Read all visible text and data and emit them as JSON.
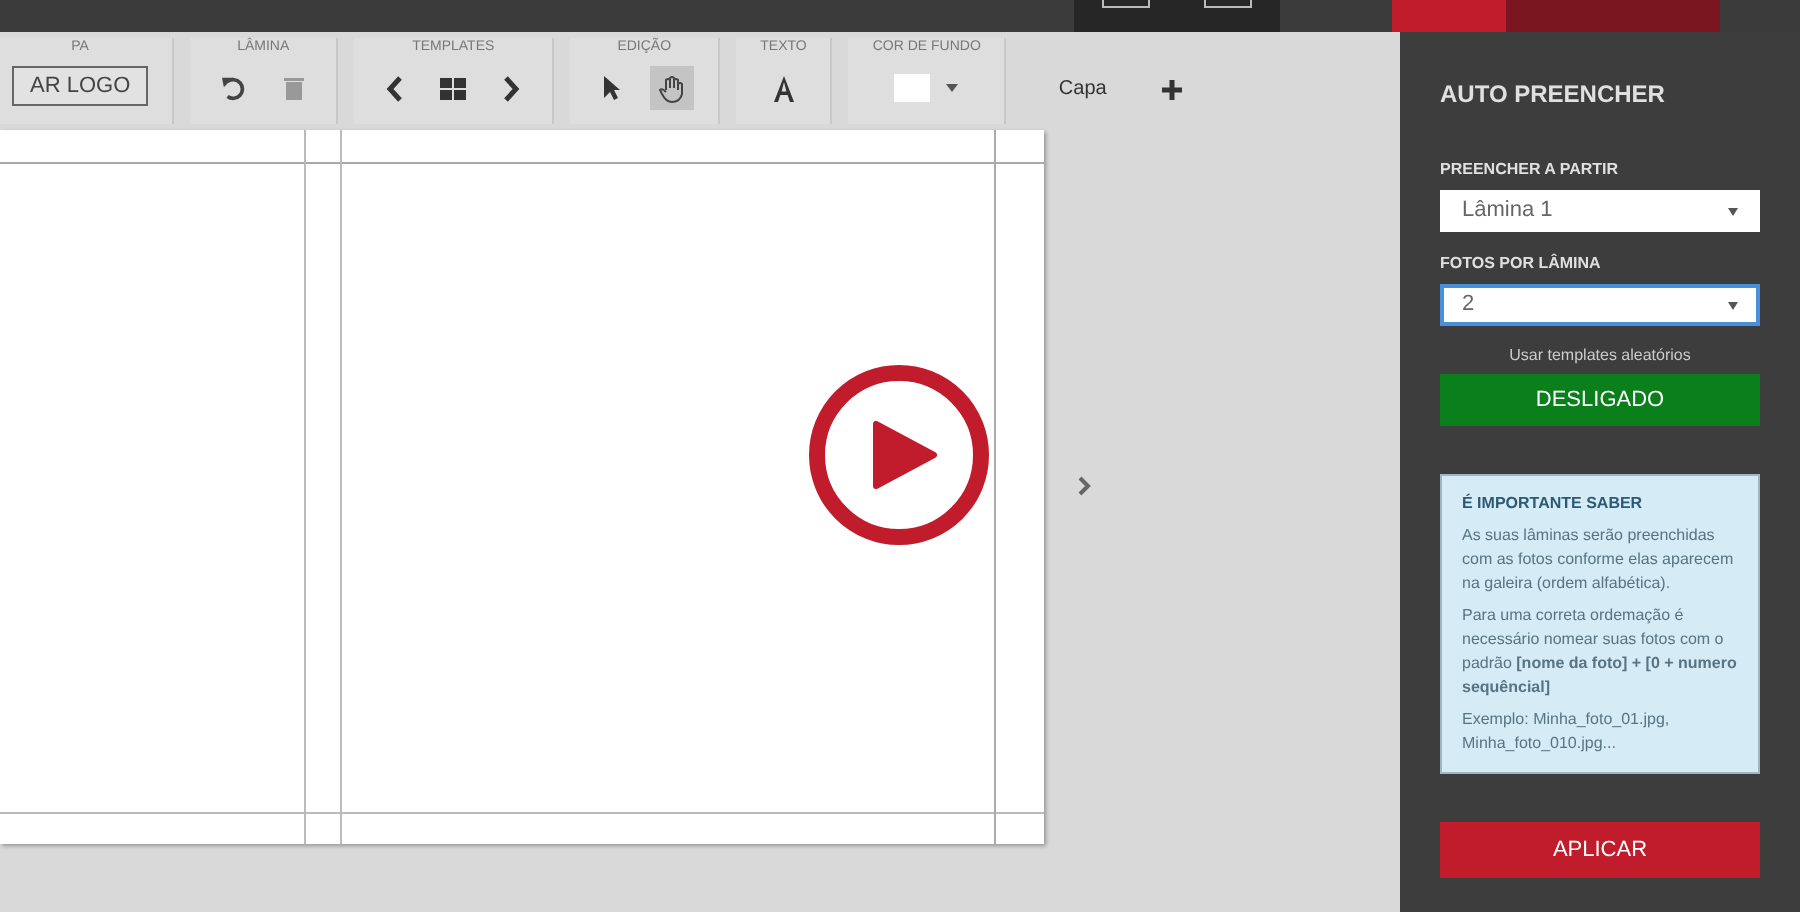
{
  "toolbar": {
    "groups": [
      {
        "label": "PA",
        "tools": [
          {
            "kind": "text-button",
            "label": "AR LOGO",
            "selected": false
          }
        ]
      },
      {
        "label": "LÂMINA",
        "tools": [
          {
            "kind": "undo",
            "selected": false
          },
          {
            "kind": "trash",
            "selected": false
          }
        ]
      },
      {
        "label": "TEMPLATES",
        "tools": [
          {
            "kind": "prev",
            "selected": false
          },
          {
            "kind": "grid",
            "selected": false
          },
          {
            "kind": "next",
            "selected": false
          }
        ]
      },
      {
        "label": "EDIÇÃO",
        "tools": [
          {
            "kind": "pointer",
            "selected": false
          },
          {
            "kind": "hand",
            "selected": true
          }
        ]
      },
      {
        "label": "TEXTO",
        "tools": [
          {
            "kind": "text",
            "selected": false
          }
        ]
      },
      {
        "label": "COR DE FUNDO",
        "tools": [
          {
            "kind": "swatch",
            "color": "#ffffff",
            "selected": false
          }
        ]
      }
    ],
    "page_label": "Capa"
  },
  "panel": {
    "title": "AUTO PREENCHER",
    "fields": [
      {
        "label": "PREENCHER A PARTIR",
        "value": "Lâmina 1",
        "focused": false
      },
      {
        "label": "FOTOS POR LÂMINA",
        "value": "2",
        "focused": true
      }
    ],
    "toggle": {
      "caption": "Usar templates aleatórios",
      "label": "DESLIGADO",
      "on": false
    },
    "info": {
      "title": "É IMPORTANTE SABER",
      "paragraphs": [
        "As suas lâminas serão preenchidas com as fotos conforme elas aparecem na galeira (ordem alfabética).",
        "Para uma correta ordemação é necessário nomear suas fotos com o padrão **[nome da foto] + [0 + numero sequêncial]**",
        "Exemplo: Minha_foto_01.jpg, Minha_foto_010.jpg..."
      ]
    },
    "apply": "APLICAR"
  }
}
